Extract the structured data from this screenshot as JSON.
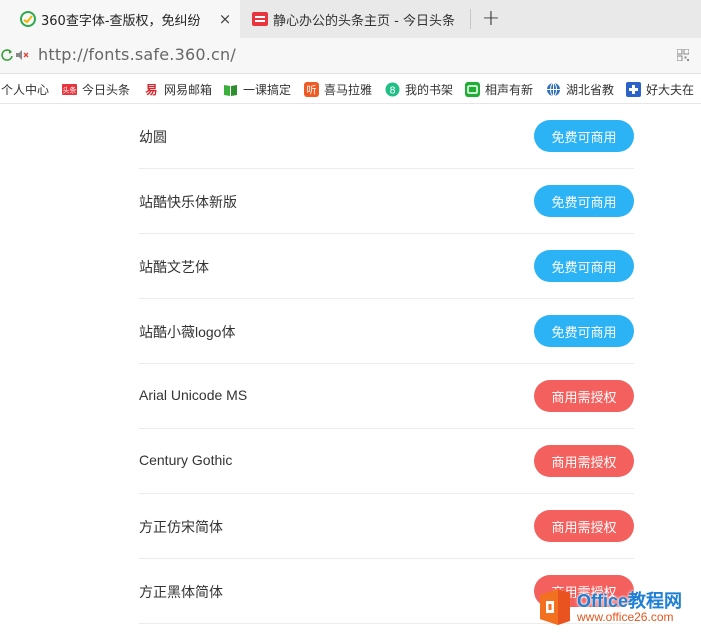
{
  "tabs": [
    {
      "title": "360查字体-查版权，免纠纷",
      "active": true,
      "close_glyph": "×"
    },
    {
      "title": "静心办公的头条主页 - 今日头条",
      "active": false
    }
  ],
  "new_tab_glyph": "+",
  "address": {
    "url": "http://fonts.safe.360.cn/"
  },
  "bookmarks": [
    {
      "label": "个人中心",
      "icon": "none"
    },
    {
      "label": "今日头条",
      "icon": "toutiao-icon",
      "icon_text": "头条",
      "color": "#e8343c"
    },
    {
      "label": "网易邮箱",
      "icon": "netease-icon",
      "icon_text": "易",
      "color": "#d7262c"
    },
    {
      "label": "一课搞定",
      "icon": "book-icon",
      "color": "#3cae3c"
    },
    {
      "label": "喜马拉雅",
      "icon": "ximalaya-icon",
      "icon_text": "听",
      "color": "#f05a23"
    },
    {
      "label": "我的书架",
      "icon": "bookshelf-icon",
      "icon_text": "8",
      "color": "#1fbf86"
    },
    {
      "label": "相声有新",
      "icon": "xiangsheng-icon",
      "color": "#1fae34"
    },
    {
      "label": "湖北省教",
      "icon": "globe-icon",
      "color": "#2e6fc0"
    },
    {
      "label": "好大夫在",
      "icon": "haodf-icon",
      "color": "#2b63c8"
    }
  ],
  "fonts": [
    {
      "name": "幼圆",
      "license": "免费可商用",
      "type": "free"
    },
    {
      "name": "站酷快乐体新版",
      "license": "免费可商用",
      "type": "free"
    },
    {
      "name": "站酷文艺体",
      "license": "免费可商用",
      "type": "free"
    },
    {
      "name": "站酷小薇logo体",
      "license": "免费可商用",
      "type": "free"
    },
    {
      "name": "Arial Unicode MS",
      "license": "商用需授权",
      "type": "paid"
    },
    {
      "name": "Century Gothic",
      "license": "商用需授权",
      "type": "paid"
    },
    {
      "name": "方正仿宋简体",
      "license": "商用需授权",
      "type": "paid"
    },
    {
      "name": "方正黑体简体",
      "license": "商用需授权",
      "type": "paid"
    }
  ],
  "watermark": {
    "brand": "Office教程网",
    "site": "www.office26.com"
  },
  "colors": {
    "free_badge": "#2bb3f5",
    "paid_badge": "#f4605e",
    "tab_bg": "#e9e9e9",
    "active_tab": "#f7f7f7"
  }
}
